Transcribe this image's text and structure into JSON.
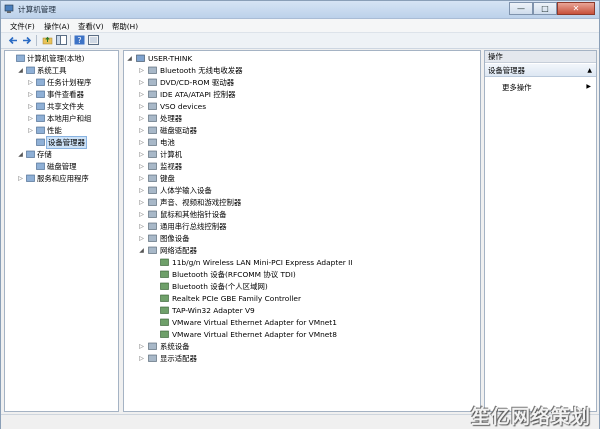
{
  "window": {
    "title": "计算机管理",
    "minimize_glyph": "—",
    "maximize_glyph": "□",
    "close_glyph": "✕"
  },
  "menu": [
    "文件(F)",
    "操作(A)",
    "查看(V)",
    "帮助(H)"
  ],
  "left_tree": [
    {
      "label": "计算机管理(本地)",
      "icon": "computer-management-icon",
      "expander": "",
      "level": 0
    },
    {
      "label": "系统工具",
      "icon": "tools-icon",
      "expander": "◢",
      "level": 1
    },
    {
      "label": "任务计划程序",
      "icon": "clock-icon",
      "expander": "▷",
      "level": 2
    },
    {
      "label": "事件查看器",
      "icon": "event-viewer-icon",
      "expander": "▷",
      "level": 2
    },
    {
      "label": "共享文件夹",
      "icon": "shared-folder-icon",
      "expander": "▷",
      "level": 2
    },
    {
      "label": "本地用户和组",
      "icon": "users-icon",
      "expander": "▷",
      "level": 2
    },
    {
      "label": "性能",
      "icon": "performance-icon",
      "expander": "▷",
      "level": 2
    },
    {
      "label": "设备管理器",
      "icon": "device-manager-icon",
      "expander": "",
      "level": 2,
      "selected": true
    },
    {
      "label": "存储",
      "icon": "storage-icon",
      "expander": "◢",
      "level": 1
    },
    {
      "label": "磁盘管理",
      "icon": "disk-icon",
      "expander": "",
      "level": 2
    },
    {
      "label": "服务和应用程序",
      "icon": "services-icon",
      "expander": "▷",
      "level": 1
    }
  ],
  "device_tree": {
    "root": "USER-THINK",
    "categories": [
      {
        "label": "Bluetooth 无线电收发器",
        "icon": "bluetooth-icon"
      },
      {
        "label": "DVD/CD-ROM 驱动器",
        "icon": "dvd-icon"
      },
      {
        "label": "IDE ATA/ATAPI 控制器",
        "icon": "ide-controller-icon"
      },
      {
        "label": "VSO devices",
        "icon": "vso-icon"
      },
      {
        "label": "处理器",
        "icon": "processor-icon"
      },
      {
        "label": "磁盘驱动器",
        "icon": "disk-drive-icon"
      },
      {
        "label": "电池",
        "icon": "battery-icon"
      },
      {
        "label": "计算机",
        "icon": "computer-icon"
      },
      {
        "label": "监视器",
        "icon": "monitor-icon"
      },
      {
        "label": "键盘",
        "icon": "keyboard-icon"
      },
      {
        "label": "人体学输入设备",
        "icon": "hid-icon"
      },
      {
        "label": "声音、视频和游戏控制器",
        "icon": "sound-icon"
      },
      {
        "label": "鼠标和其他指针设备",
        "icon": "mouse-icon"
      },
      {
        "label": "通用串行总线控制器",
        "icon": "usb-icon"
      },
      {
        "label": "图像设备",
        "icon": "camera-icon"
      },
      {
        "label": "网络适配器",
        "icon": "network-adapter-icon",
        "expanded": true
      }
    ],
    "network_adapters": [
      "11b/g/n  Wireless LAN Mini-PCI Express Adapter II",
      "Bluetooth 设备(RFCOMM 协议 TDI)",
      "Bluetooth 设备(个人区域网)",
      "Realtek PCIe GBE Family Controller",
      "TAP-Win32 Adapter V9",
      "VMware Virtual Ethernet Adapter for VMnet1",
      "VMware Virtual Ethernet Adapter for VMnet8"
    ],
    "after": [
      {
        "label": "系统设备",
        "icon": "system-devices-icon"
      },
      {
        "label": "显示适配器",
        "icon": "display-adapter-icon"
      }
    ]
  },
  "actions": {
    "header": "操作",
    "group": "设备管理器",
    "more": "更多操作"
  },
  "watermark": "笙亿网络策划",
  "colors": {
    "selection": "#cde2f7",
    "title_gradient": "#bcd1ea"
  }
}
